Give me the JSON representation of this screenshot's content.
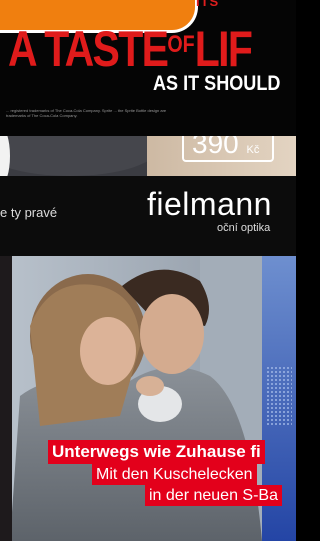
{
  "movie_banner": {
    "top_fragment": "ITS",
    "headline_pre": "A",
    "headline_taste": "TASTE",
    "headline_of": "OF",
    "headline_life": "LIF",
    "subline": "AS IT SHOULD",
    "fineprint": "... registered trademarks of The Coca-Cola Company. Sprite ... the Sprite Bottle design are trademarks of The Coca-Cola Company."
  },
  "price_tag": {
    "amount": "390",
    "currency": "Kč"
  },
  "fielmann_ad": {
    "slogan_fragment": "e ty pravé",
    "brand": "fielmann",
    "tagline": "oční optika"
  },
  "train_ad": {
    "headline_1": "Unterwegs wie Zuhause fi",
    "headline_2": "Mit den Kuschelecken",
    "headline_3": "in der neuen S-Ba"
  },
  "colors": {
    "banner_red": "#e01b1b",
    "orange_tab": "#f07f0f",
    "db_red": "#e3001b"
  }
}
